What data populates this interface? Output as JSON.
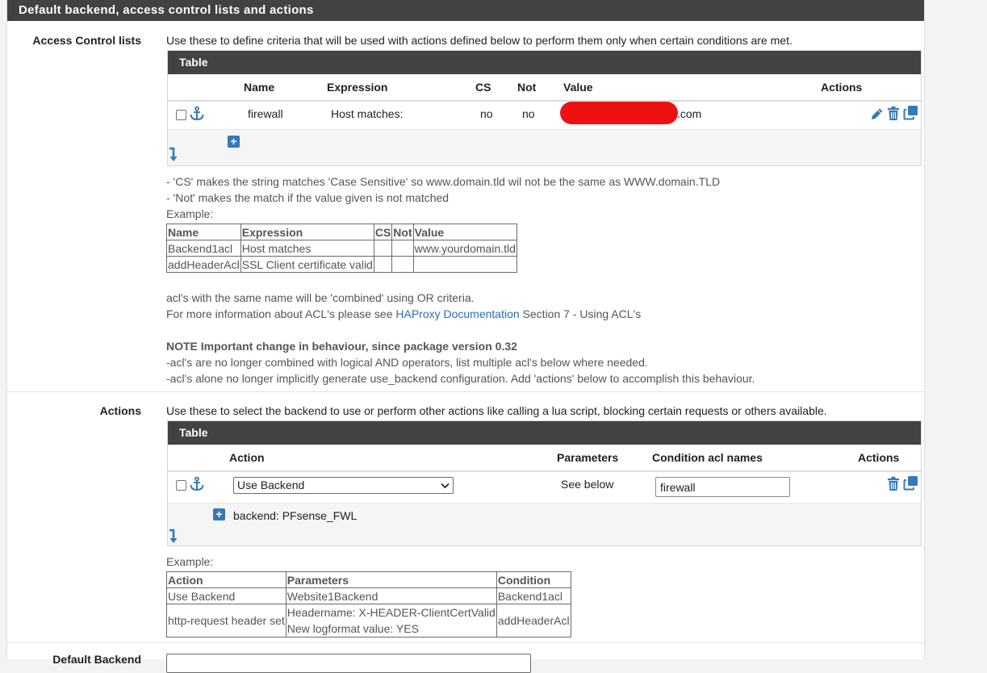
{
  "section": {
    "title": "Default backend, access control lists and actions"
  },
  "acl": {
    "label": "Access Control lists",
    "help": "Use these to define criteria that will be used with actions defined below to perform them only when certain conditions are met.",
    "table_title": "Table",
    "columns": [
      "Name",
      "Expression",
      "CS",
      "Not",
      "Value",
      "Actions"
    ],
    "row": {
      "name": "firewall",
      "expression": "Host matches:",
      "cs": "no",
      "not": "no",
      "value_suffix": ".com"
    },
    "notes": [
      "- 'CS' makes the string matches 'Case Sensitive' so www.domain.tld wil not be the same as WWW.domain.TLD",
      "- 'Not' makes the match if the value given is not matched",
      "Example:"
    ],
    "example": {
      "headers": [
        "Name",
        "Expression",
        "CS",
        "Not",
        "Value"
      ],
      "rows": [
        [
          "Backend1acl",
          "Host matches",
          "",
          "",
          "www.yourdomain.tld"
        ],
        [
          "addHeaderAcl",
          "SSL Client certificate valid",
          "",
          "",
          ""
        ]
      ]
    },
    "combined_note": "acl's with the same name will be 'combined' using OR criteria.",
    "more_info_prefix": "For more information about ACL's please see ",
    "more_info_link": "HAProxy Documentation",
    "more_info_suffix": " Section 7 - Using ACL's",
    "note_heading": "NOTE Important change in behaviour, since package version 0.32",
    "note_lines": [
      "-acl's are no longer combined with logical AND operators, list multiple acl's below where needed.",
      "-acl's alone no longer implicitly generate use_backend configuration. Add 'actions' below to accomplish this behaviour."
    ]
  },
  "actions": {
    "label": "Actions",
    "help": "Use these to select the backend to use or perform other actions like calling a lua script, blocking certain requests or others available.",
    "table_title": "Table",
    "columns": [
      "Action",
      "Parameters",
      "Condition acl names",
      "Actions"
    ],
    "row": {
      "action": "Use Backend",
      "parameters": "See below",
      "condition": "firewall"
    },
    "subrow": "backend: PFsense_FWL",
    "example_label": "Example:",
    "example": {
      "headers": [
        "Action",
        "Parameters",
        "Condition"
      ],
      "rows": [
        [
          "Use Backend",
          "Website1Backend",
          "Backend1acl"
        ],
        [
          "http-request header set",
          "Headername: X-HEADER-ClientCertValid",
          "addHeaderAcl"
        ]
      ],
      "row2_param_line2": "New logformat value: YES"
    }
  },
  "default_backend": {
    "label": "Default Backend"
  },
  "colors": {
    "header_bg": "#424242",
    "link": "#2a6fb0",
    "icon_blue": "#337ab7",
    "redaction": "#ee1111"
  }
}
